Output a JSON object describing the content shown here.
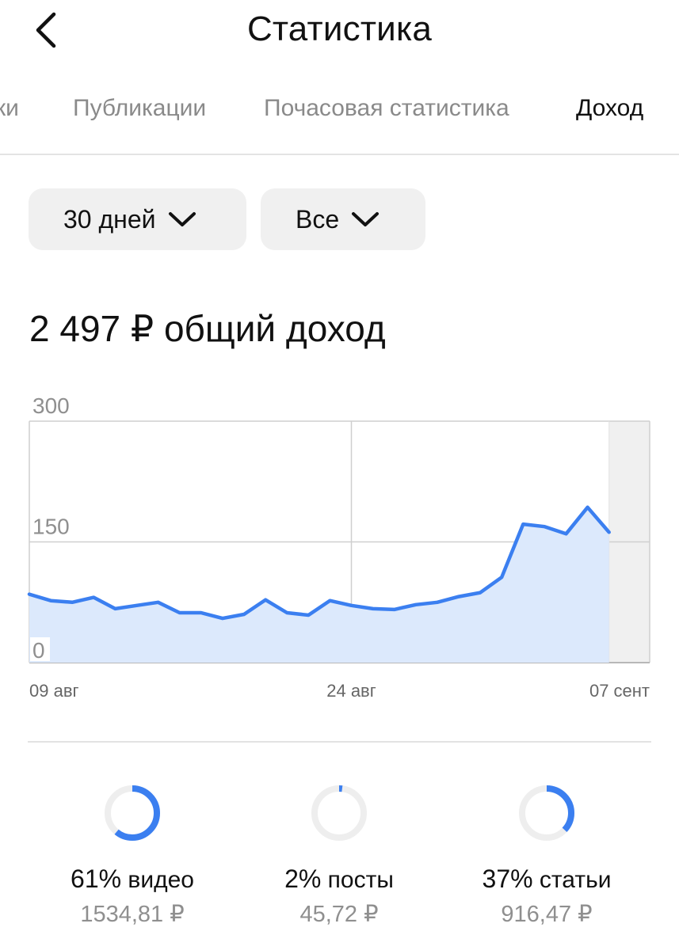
{
  "header": {
    "title": "Статистика"
  },
  "tabs": [
    {
      "label": "ки",
      "active": false
    },
    {
      "label": "Публикации",
      "active": false
    },
    {
      "label": "Почасовая статистика",
      "active": false
    },
    {
      "label": "Доход",
      "active": true
    }
  ],
  "filters": {
    "period": "30 дней",
    "type": "Все"
  },
  "total": {
    "label": "2 497 ₽ общий доход"
  },
  "chart_data": {
    "type": "area",
    "ylim": [
      0,
      300
    ],
    "yticks": [
      "0",
      "150",
      "300"
    ],
    "xtick_labels": [
      "09 авг",
      "24 авг",
      "07 сент"
    ],
    "values": [
      85,
      77,
      75,
      81,
      67,
      71,
      75,
      62,
      62,
      55,
      60,
      78,
      62,
      59,
      77,
      71,
      67,
      66,
      72,
      75,
      82,
      87,
      106,
      172,
      169,
      160,
      193,
      162
    ],
    "colors": {
      "line": "#3b7ff0",
      "fill": "#dce9fc",
      "grid": "#cfcfcf",
      "future": "#f0f0f0"
    }
  },
  "breakdown": [
    {
      "percent_label": "61%",
      "name": "видео",
      "amount": "1534,81 ₽",
      "fraction": 0.61
    },
    {
      "percent_label": "2%",
      "name": "посты",
      "amount": "45,72 ₽",
      "fraction": 0.02
    },
    {
      "percent_label": "37%",
      "name": "статьи",
      "amount": "916,47 ₽",
      "fraction": 0.37
    }
  ],
  "colors": {
    "accent": "#3b7ff0",
    "ring_track": "#eeeeee"
  }
}
